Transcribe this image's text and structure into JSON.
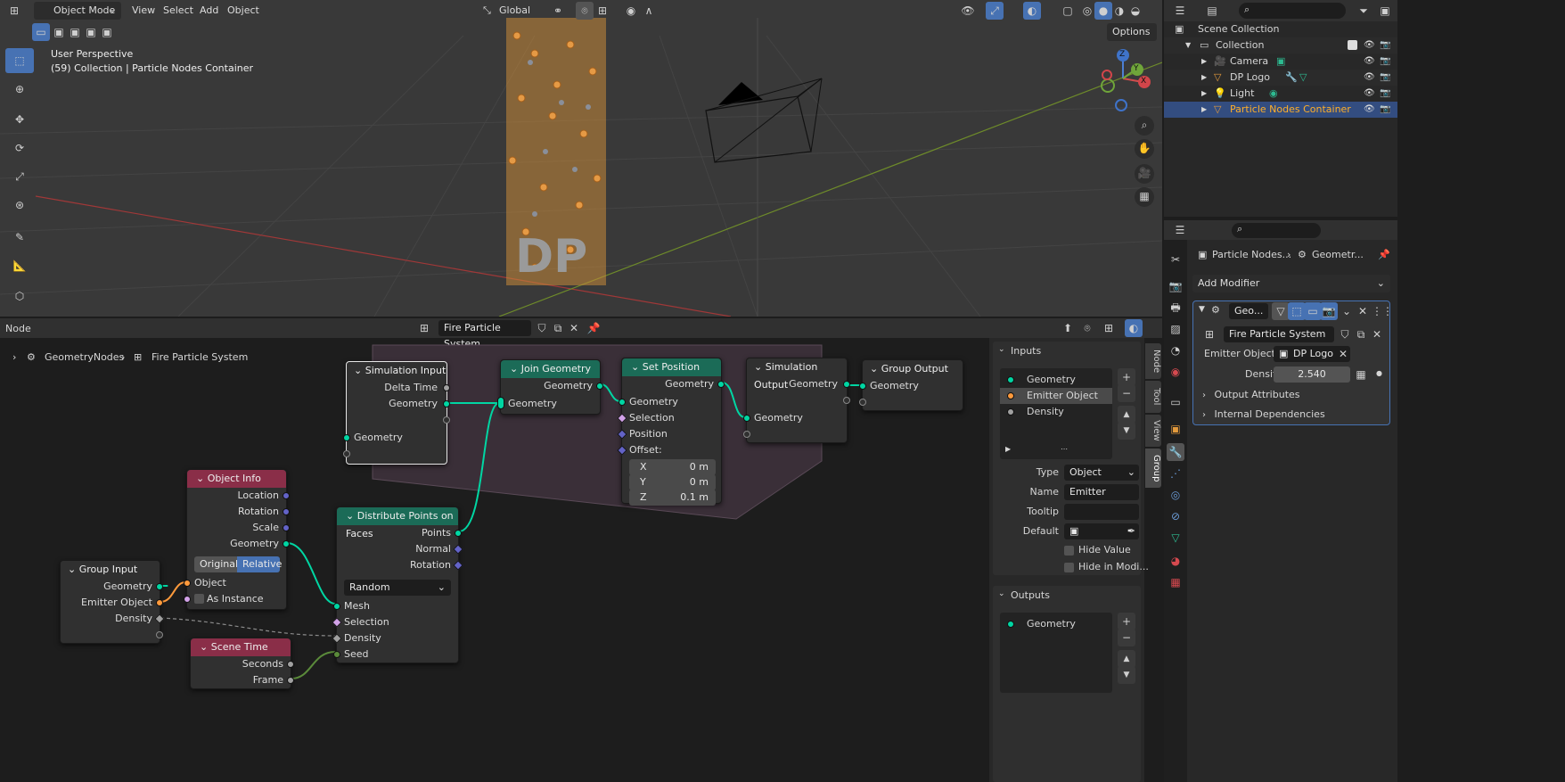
{
  "viewport": {
    "mode": "Object Mode",
    "menu": [
      "View",
      "Select",
      "Add",
      "Object"
    ],
    "orientation": "Global",
    "options_label": "Options",
    "title": "User Perspective",
    "subtitle": "(59) Collection | Particle Nodes Container",
    "gizmo_x": "X",
    "gizmo_y": "Y",
    "gizmo_z": "Z",
    "logo_text": "DP"
  },
  "outliner": {
    "scene_collection": "Scene Collection",
    "collection": "Collection",
    "items": [
      {
        "label": "Camera"
      },
      {
        "label": "DP Logo"
      },
      {
        "label": "Light"
      },
      {
        "label": "Particle Nodes Container"
      }
    ]
  },
  "properties": {
    "breadcrumb_object": "Particle Nodes...",
    "breadcrumb_modifier": "Geometr...",
    "add_modifier": "Add Modifier",
    "modifier_name": "Geo...",
    "node_group": "Fire Particle System",
    "emitter_label": "Emitter Object",
    "emitter_value": "DP Logo",
    "density_label": "Density",
    "density_value": "2.540",
    "output_attributes": "Output Attributes",
    "internal_dependencies": "Internal Dependencies"
  },
  "node_editor": {
    "menu": "Node",
    "node_tree": "Fire Particle System",
    "breadcrumb_1": "GeometryNodes",
    "breadcrumb_2": "Fire Particle System",
    "tabs": [
      "Node",
      "Tool",
      "View",
      "Group"
    ],
    "inputs_title": "Inputs",
    "inputs": [
      "Geometry",
      "Emitter Object",
      "Density"
    ],
    "type_label": "Type",
    "type_value": "Object",
    "name_label": "Name",
    "name_value": "Emitter Object",
    "tooltip_label": "Tooltip",
    "default_label": "Default",
    "hide_value": "Hide Value",
    "hide_modifier": "Hide in Modi...",
    "outputs_title": "Outputs",
    "outputs": [
      "Geometry"
    ]
  },
  "nodes": {
    "sim_input": {
      "title": "Simulation Input",
      "delta": "Delta Time",
      "geo_out": "Geometry",
      "geo_in": "Geometry"
    },
    "join": {
      "title": "Join Geometry",
      "geo_out": "Geometry",
      "geo_in": "Geometry"
    },
    "set_pos": {
      "title": "Set Position",
      "geo_out": "Geometry",
      "geo_in": "Geometry",
      "selection": "Selection",
      "position": "Position",
      "offset": "Offset:",
      "x_label": "X",
      "x_val": "0 m",
      "y_label": "Y",
      "y_val": "0 m",
      "z_label": "Z",
      "z_val": "0.1 m"
    },
    "sim_output": {
      "title": "Simulation Output",
      "geo_out": "Geometry",
      "geo_in": "Geometry"
    },
    "group_output": {
      "title": "Group Output",
      "geo": "Geometry"
    },
    "object_info": {
      "title": "Object Info",
      "location": "Location",
      "rotation": "Rotation",
      "scale": "Scale",
      "geometry": "Geometry",
      "original": "Original",
      "relative": "Relative",
      "object": "Object",
      "as_instance": "As Instance"
    },
    "distribute": {
      "title": "Distribute Points on Faces",
      "points": "Points",
      "normal": "Normal",
      "rotation": "Rotation",
      "method": "Random",
      "mesh": "Mesh",
      "selection": "Selection",
      "density": "Density",
      "seed": "Seed"
    },
    "group_input": {
      "title": "Group Input",
      "geometry": "Geometry",
      "emitter": "Emitter Object",
      "density": "Density"
    },
    "scene_time": {
      "title": "Scene Time",
      "seconds": "Seconds",
      "frame": "Frame"
    }
  },
  "colors": {
    "accent": "#4772b3",
    "geometry_socket": "#00d6a3",
    "object_socket": "#ff9a3c",
    "vector_socket": "#6363c7",
    "selected_row": "#334d80",
    "header_green": "#1b6b57",
    "header_red": "#8a2e48"
  }
}
